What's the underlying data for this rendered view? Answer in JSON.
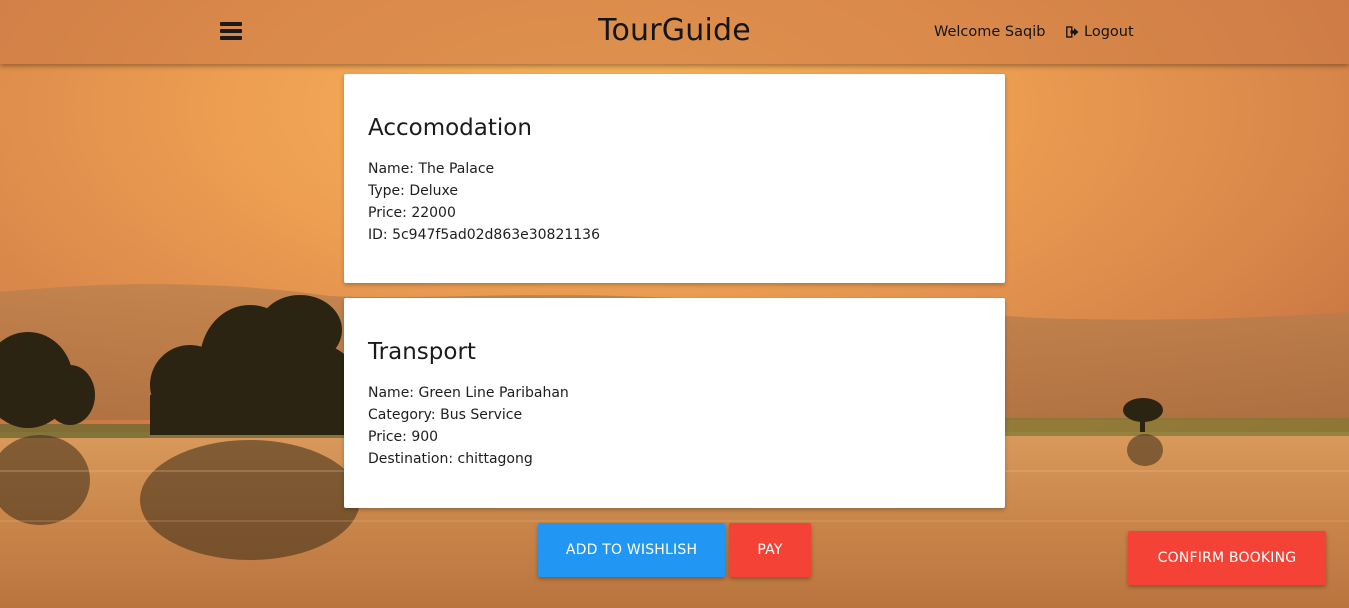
{
  "header": {
    "brand": "TourGuide",
    "welcome": "Welcome Saqib",
    "logout_label": "Logout"
  },
  "accommodation": {
    "title": "Accomodation",
    "lines": [
      "Name: The Palace",
      "Type: Deluxe",
      "Price: 22000",
      "ID: 5c947f5ad02d863e30821136"
    ]
  },
  "transport": {
    "title": "Transport",
    "lines": [
      "Name: Green Line Paribahan",
      "Category: Bus Service",
      "Price: 900",
      "Destination: chittagong"
    ]
  },
  "actions": {
    "wishlist_label": "ADD TO WISHLISH",
    "pay_label": "PAY",
    "confirm_label": "CONFIRM BOOKING"
  },
  "colors": {
    "primary_blue": "#2196f3",
    "accent_red": "#f44336",
    "sunset_orange": "#f0a050"
  },
  "icons": {
    "menu": "hamburger-menu-icon",
    "logout": "logout-icon"
  }
}
